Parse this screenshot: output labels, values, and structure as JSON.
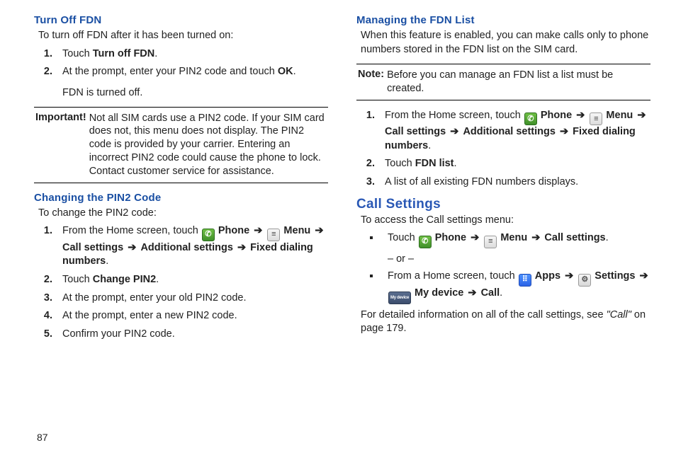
{
  "pageNumber": "87",
  "left": {
    "turnOff": {
      "heading": "Turn Off FDN",
      "intro": "To turn off FDN after it has been turned on:",
      "steps": {
        "s1a": "Touch ",
        "s1b": "Turn off FDN",
        "s1c": ".",
        "s2a": "At the prompt, enter your PIN2 code and touch ",
        "s2b": "OK",
        "s2c": ".",
        "s2sub": "FDN is turned off."
      },
      "importantLabel": "Important!",
      "importantText": "Not all SIM cards use a PIN2 code. If your SIM card does not, this menu does not display. The PIN2 code is provided by your carrier. Entering an incorrect PIN2 code could cause the phone to lock. Contact customer service for assistance."
    },
    "changePin": {
      "heading": "Changing the PIN2 Code",
      "intro": "To change the PIN2 code:",
      "steps": {
        "s1a": "From the Home screen, touch ",
        "phone": "Phone",
        "menu": "Menu",
        "call": "Call settings",
        "addl": "Additional settings",
        "fdn": "Fixed dialing numbers",
        "s2a": "Touch ",
        "s2b": "Change PIN2",
        "s2c": ".",
        "s3": "At the prompt, enter your old PIN2 code.",
        "s4": "At the prompt, enter a new PIN2 code.",
        "s5": "Confirm your PIN2 code."
      }
    }
  },
  "right": {
    "manage": {
      "heading": "Managing the FDN List",
      "intro": "When this feature is enabled, you can make calls only to phone numbers stored in the FDN list on the SIM card.",
      "noteLabel": "Note:",
      "noteText": "Before you can manage an FDN list a list must be created.",
      "steps": {
        "s1a": "From the Home screen, touch ",
        "phone": "Phone",
        "menu": "Menu",
        "call": "Call settings",
        "addl": "Additional settings",
        "fdn": "Fixed dialing numbers",
        "s2a": "Touch ",
        "s2b": "FDN list",
        "s2c": ".",
        "s3": "A list of all existing FDN numbers displays."
      }
    },
    "callSettings": {
      "heading": "Call Settings",
      "intro": "To access the Call settings menu:",
      "opt1": {
        "pre": "Touch ",
        "phone": "Phone",
        "menu": "Menu",
        "call": "Call settings"
      },
      "or": "– or –",
      "opt2": {
        "pre": "From a Home screen, touch ",
        "apps": "Apps",
        "settings": "Settings",
        "mydevice": "My device",
        "call": "Call"
      },
      "footer1": "For detailed information on all of the call settings, see ",
      "footerRef": "\"Call\"",
      "footer2": " on page 179."
    }
  },
  "icons": {
    "phone": "✆",
    "menu": "≡",
    "apps": "⠿",
    "settings": "⚙",
    "mydevice": "My device"
  },
  "arrow": "➔"
}
